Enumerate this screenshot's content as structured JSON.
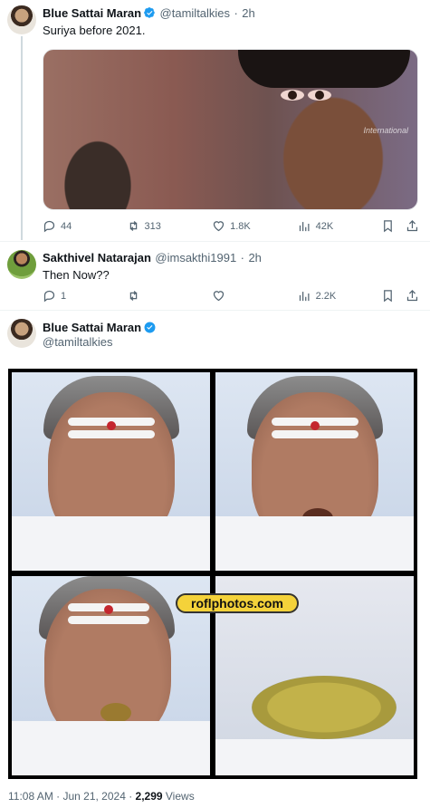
{
  "tweet1": {
    "name": "Blue Sattai Maran",
    "handle": "@tamiltalkies",
    "time": "2h",
    "text": "Suriya before 2021.",
    "media_watermark": "International",
    "reply_count": "44",
    "retweet_count": "313",
    "like_count": "1.8K",
    "view_count": "42K"
  },
  "tweet2": {
    "name": "Sakthivel Natarajan",
    "handle": "@imsakthi1991",
    "time": "2h",
    "text": "Then Now??",
    "reply_count": "1",
    "view_count": "2.2K"
  },
  "main_tweet": {
    "name": "Blue Sattai Maran",
    "handle": "@tamiltalkies",
    "media_watermark": "roflphotos.com",
    "timestamp": "11:08 AM · Jun 21, 2024 · ",
    "views_count": "2,299",
    "views_label": " Views"
  },
  "colors": {
    "verified_blue": "#1d9bf0",
    "secondary_text": "#536471"
  },
  "icons": [
    "verified-badge-icon",
    "reply-icon",
    "retweet-icon",
    "like-icon",
    "views-icon",
    "bookmark-icon",
    "share-icon"
  ]
}
